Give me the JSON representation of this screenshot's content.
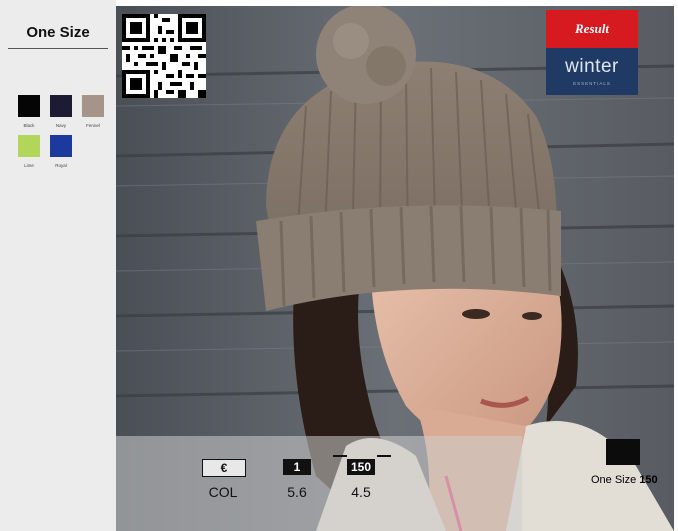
{
  "sidebar": {
    "size_title": "One Size",
    "colors": [
      {
        "name": "Black",
        "hex": "#050505"
      },
      {
        "name": "Navy",
        "hex": "#1d1b33"
      },
      {
        "name": "Fennel",
        "hex": "#a79488"
      },
      {
        "name": "Lime",
        "hex": "#b1d65a"
      },
      {
        "name": "Royal",
        "hex": "#1c3a9e"
      }
    ]
  },
  "brand": {
    "top_text": "Result",
    "word": "winter",
    "sub": "ESSENTIALS",
    "top_color": "#d71920",
    "bottom_color": "#1f3a64"
  },
  "info": {
    "currency_header": "€",
    "pack_header": "1",
    "carton_header": "150",
    "currency_value": "COL",
    "pack_value": "5.6",
    "carton_value": "4.5"
  },
  "size_box": {
    "label": "One Size",
    "count": "150"
  },
  "icons": {
    "qr": "qr-code-icon",
    "size": "carton-box-icon"
  }
}
